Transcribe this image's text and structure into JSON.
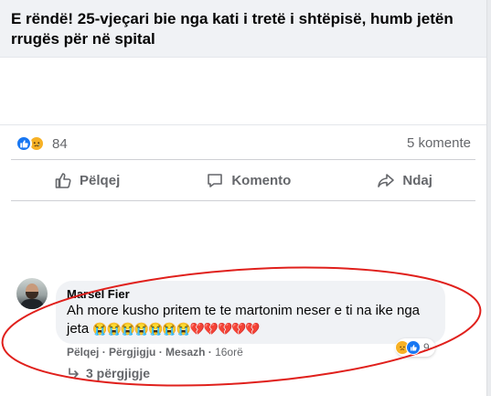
{
  "post": {
    "title": "E rëndë! 25-vjeçari bie nga kati i tretë i shtëpisë, humb jetën rrugës për në spital"
  },
  "stats": {
    "reaction_count": "84",
    "comments": "5 komente",
    "reaction_icons": [
      "like-icon",
      "sad-icon"
    ]
  },
  "actions": {
    "like": "Pëlqej",
    "comment": "Komento",
    "share": "Ndaj"
  },
  "comment": {
    "author": "Marsel Fier",
    "text": "Ah more kusho pritem te te martonim neser e ti na ike nga jeta",
    "emojis": "😭😭😭😭😭😭😭💔💔💔💔💔",
    "like_label": "Pëlqej",
    "reply_label": "Përgjigju",
    "message_label": "Mesazh",
    "time": "16orë",
    "reaction_count": "9",
    "replies": "3 përgjigje"
  },
  "colors": {
    "accent": "#1877f2",
    "sad": "#f7b125",
    "annotation": "#e0201c"
  }
}
